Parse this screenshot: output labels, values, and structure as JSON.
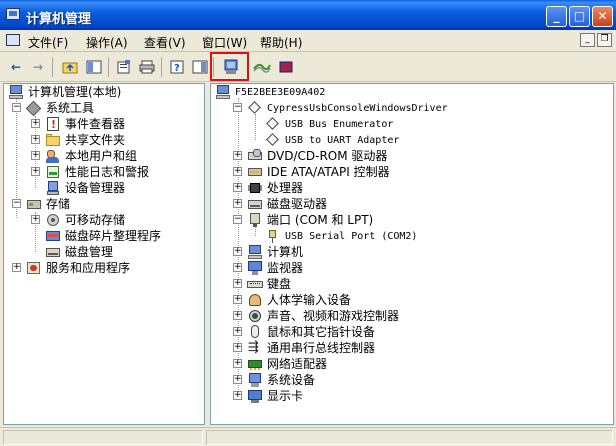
{
  "window": {
    "title": "计算机管理",
    "min": "_",
    "max": "□",
    "close": "✕"
  },
  "menu": {
    "items": [
      {
        "label": "文件(F)"
      },
      {
        "label": "操作(A)"
      },
      {
        "label": "查看(V)"
      },
      {
        "label": "窗口(W)"
      },
      {
        "label": "帮助(H)"
      }
    ],
    "mdi_min": "_",
    "mdi_restore": "❐"
  },
  "toolbar": {
    "back": "←",
    "forward": "→"
  },
  "left_tree": {
    "root": "计算机管理(本地)",
    "items": [
      {
        "label": "系统工具"
      },
      {
        "label": "事件查看器"
      },
      {
        "label": "共享文件夹"
      },
      {
        "label": "本地用户和组"
      },
      {
        "label": "性能日志和警报"
      },
      {
        "label": "设备管理器"
      },
      {
        "label": "存储"
      },
      {
        "label": "可移动存储"
      },
      {
        "label": "磁盘碎片整理程序"
      },
      {
        "label": "磁盘管理"
      },
      {
        "label": "服务和应用程序"
      }
    ]
  },
  "right_tree": {
    "root": "F5E2BEE3E09A402",
    "items": [
      {
        "label": "CypressUsbConsoleWindowsDriver"
      },
      {
        "label": "USB Bus Enumerator"
      },
      {
        "label": "USB to UART Adapter"
      },
      {
        "label": "DVD/CD-ROM 驱动器"
      },
      {
        "label": "IDE ATA/ATAPI 控制器"
      },
      {
        "label": "处理器"
      },
      {
        "label": "磁盘驱动器"
      },
      {
        "label": "端口 (COM 和 LPT)"
      },
      {
        "label": "USB Serial Port (COM2)"
      },
      {
        "label": "计算机"
      },
      {
        "label": "监视器"
      },
      {
        "label": "键盘"
      },
      {
        "label": "人体学输入设备"
      },
      {
        "label": "声音、视频和游戏控制器"
      },
      {
        "label": "鼠标和其它指针设备"
      },
      {
        "label": "通用串行总线控制器"
      },
      {
        "label": "网络适配器"
      },
      {
        "label": "系统设备"
      },
      {
        "label": "显示卡"
      }
    ]
  },
  "expander": {
    "plus": "+",
    "minus": "−"
  }
}
